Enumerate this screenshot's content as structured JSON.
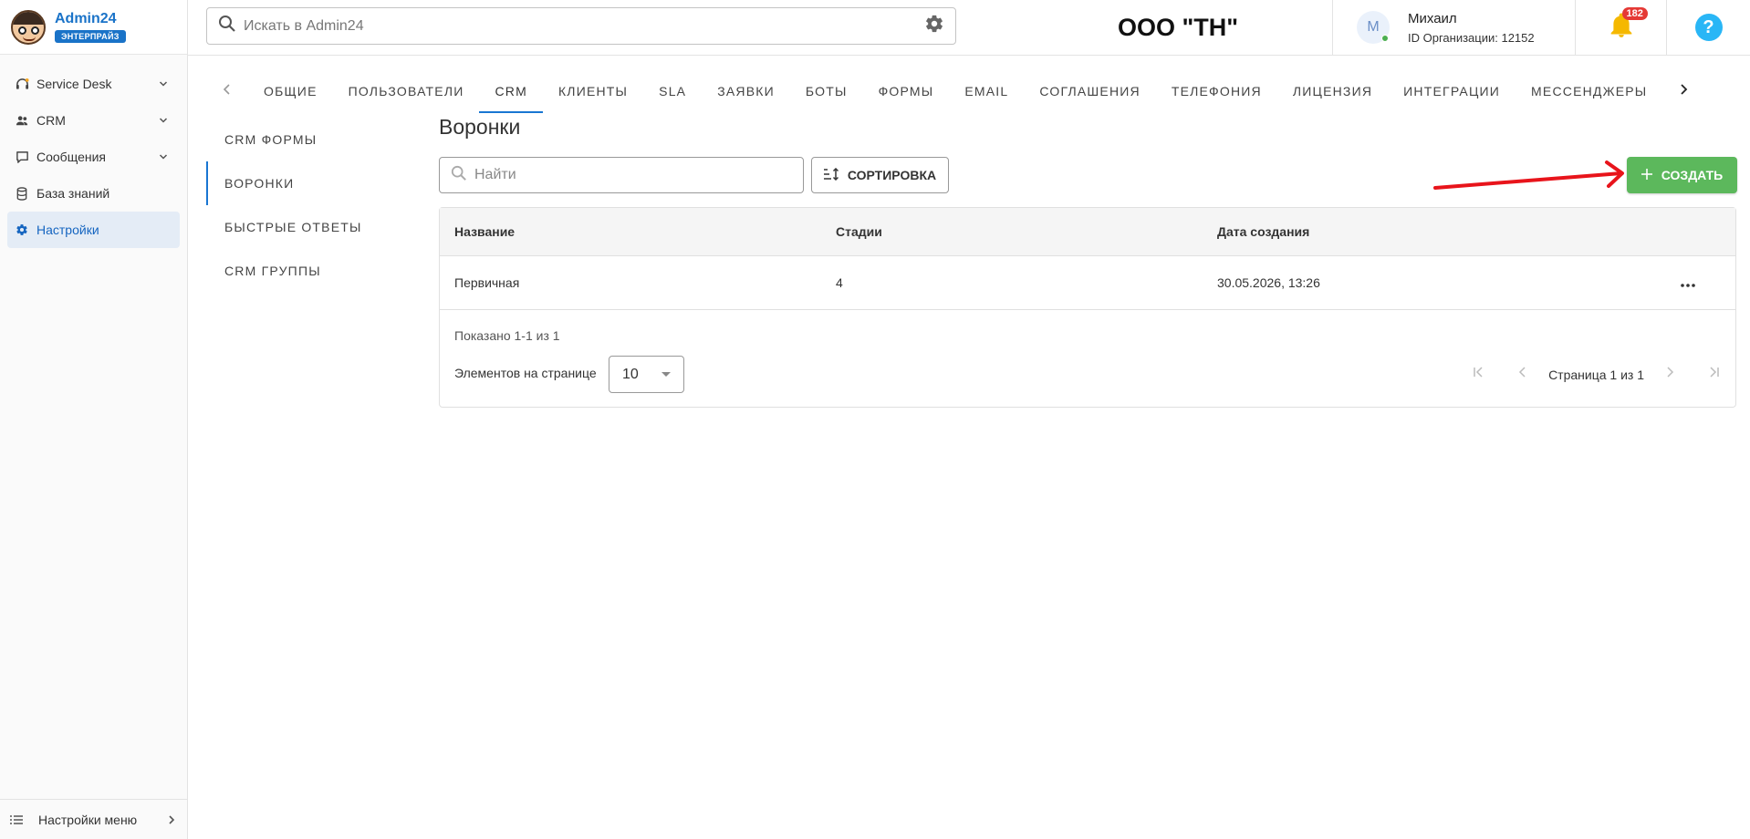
{
  "brand": {
    "name": "Admin24",
    "badge": "ЭНТЕРПРАЙЗ"
  },
  "sidebar": {
    "items": [
      {
        "label": "Service Desk",
        "icon": "headset-icon",
        "expandable": true,
        "active": false
      },
      {
        "label": "CRM",
        "icon": "users-icon",
        "expandable": true,
        "active": false
      },
      {
        "label": "Сообщения",
        "icon": "message-icon",
        "expandable": true,
        "active": false
      },
      {
        "label": "База знаний",
        "icon": "database-icon",
        "expandable": false,
        "active": false
      },
      {
        "label": "Настройки",
        "icon": "gear-icon",
        "expandable": false,
        "active": true
      }
    ],
    "footer_label": "Настройки меню"
  },
  "topbar": {
    "search_placeholder": "Искать в Admin24",
    "org_title": "ООО \"ТН\"",
    "user": {
      "initial": "М",
      "name": "Михаил",
      "org_id": "ID Организации: 12152"
    },
    "notifications_count": "182",
    "help_label": "?"
  },
  "tabs": [
    {
      "label": "ОБЩИЕ",
      "active": false
    },
    {
      "label": "ПОЛЬЗОВАТЕЛИ",
      "active": false
    },
    {
      "label": "CRM",
      "active": true
    },
    {
      "label": "КЛИЕНТЫ",
      "active": false
    },
    {
      "label": "SLA",
      "active": false
    },
    {
      "label": "ЗАЯВКИ",
      "active": false
    },
    {
      "label": "БОТЫ",
      "active": false
    },
    {
      "label": "ФОРМЫ",
      "active": false
    },
    {
      "label": "EMAIL",
      "active": false
    },
    {
      "label": "СОГЛАШЕНИЯ",
      "active": false
    },
    {
      "label": "ТЕЛЕФОНИЯ",
      "active": false
    },
    {
      "label": "ЛИЦЕНЗИЯ",
      "active": false
    },
    {
      "label": "ИНТЕГРАЦИИ",
      "active": false
    },
    {
      "label": "МЕССЕНДЖЕРЫ",
      "active": false
    }
  ],
  "submenu": [
    {
      "label": "CRM ФОРМЫ",
      "active": false
    },
    {
      "label": "ВОРОНКИ",
      "active": true
    },
    {
      "label": "БЫСТРЫЕ ОТВЕТЫ",
      "active": false
    },
    {
      "label": "CRM ГРУППЫ",
      "active": false
    }
  ],
  "main": {
    "title": "Воронки",
    "find_placeholder": "Найти",
    "sort_label": "СОРТИРОВКА",
    "create_label": "СОЗДАТЬ",
    "table": {
      "columns": [
        "Название",
        "Стадии",
        "Дата создания"
      ],
      "rows": [
        {
          "name": "Первичная",
          "stages": "4",
          "created": "30.05.2026, 13:26"
        }
      ]
    },
    "shown": "Показано 1-1 из 1",
    "per_page_label": "Элементов на странице",
    "per_page_value": "10",
    "page_text": "Страница 1 из 1"
  },
  "colors": {
    "accent": "#1976d2",
    "create": "#5cb85c",
    "annotation_arrow": "#e8141b",
    "badge": "#e53935"
  }
}
